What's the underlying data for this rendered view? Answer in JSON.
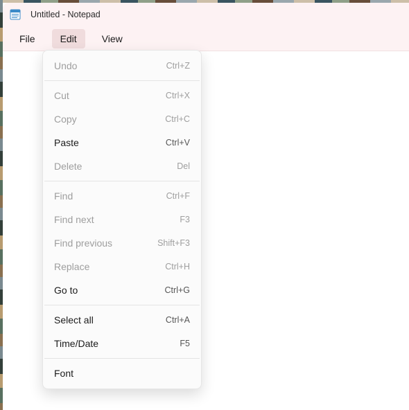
{
  "window": {
    "title": "Untitled - Notepad"
  },
  "menubar": {
    "items": [
      {
        "label": "File",
        "active": false
      },
      {
        "label": "Edit",
        "active": true
      },
      {
        "label": "View",
        "active": false
      }
    ]
  },
  "edit_menu": {
    "groups": [
      [
        {
          "label": "Undo",
          "shortcut": "Ctrl+Z",
          "enabled": false
        }
      ],
      [
        {
          "label": "Cut",
          "shortcut": "Ctrl+X",
          "enabled": false
        },
        {
          "label": "Copy",
          "shortcut": "Ctrl+C",
          "enabled": false
        },
        {
          "label": "Paste",
          "shortcut": "Ctrl+V",
          "enabled": true
        },
        {
          "label": "Delete",
          "shortcut": "Del",
          "enabled": false
        }
      ],
      [
        {
          "label": "Find",
          "shortcut": "Ctrl+F",
          "enabled": false
        },
        {
          "label": "Find next",
          "shortcut": "F3",
          "enabled": false
        },
        {
          "label": "Find previous",
          "shortcut": "Shift+F3",
          "enabled": false
        },
        {
          "label": "Replace",
          "shortcut": "Ctrl+H",
          "enabled": false
        },
        {
          "label": "Go to",
          "shortcut": "Ctrl+G",
          "enabled": true
        }
      ],
      [
        {
          "label": "Select all",
          "shortcut": "Ctrl+A",
          "enabled": true
        },
        {
          "label": "Time/Date",
          "shortcut": "F5",
          "enabled": true
        }
      ],
      [
        {
          "label": "Font",
          "shortcut": "",
          "enabled": true
        }
      ]
    ]
  }
}
